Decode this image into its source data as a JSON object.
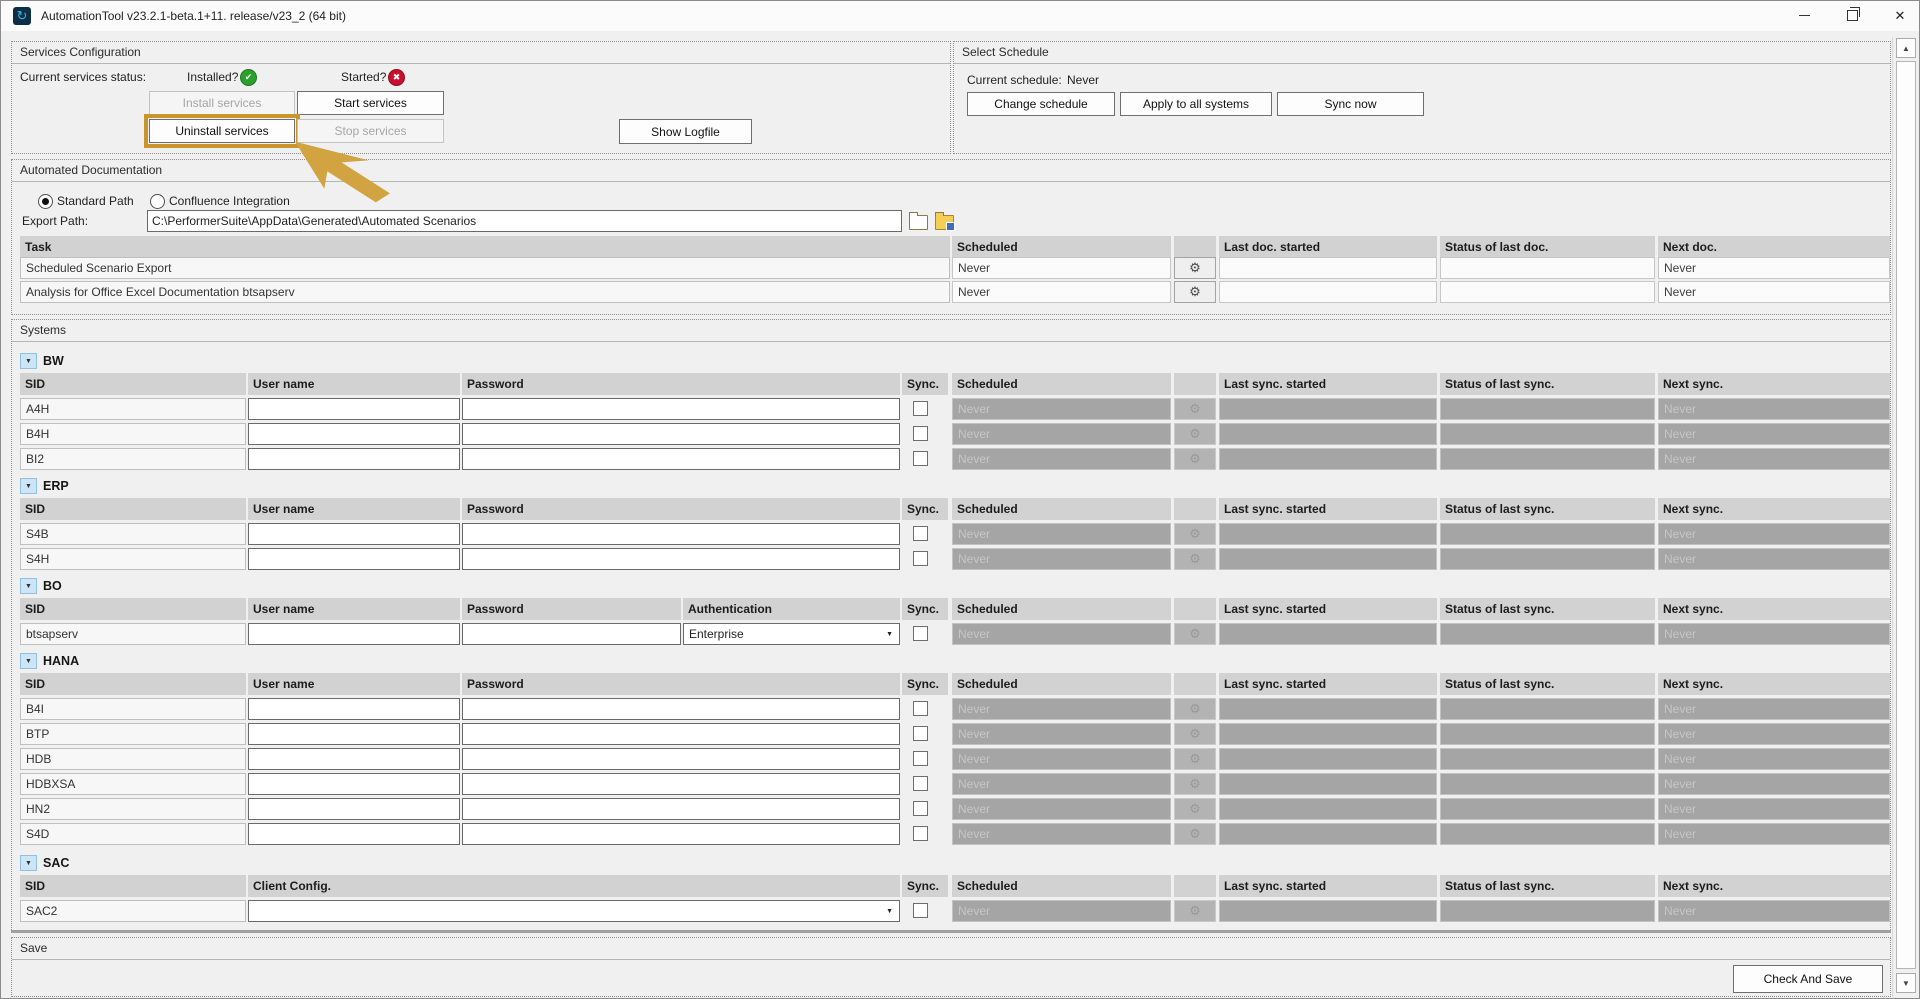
{
  "window": {
    "title": "AutomationTool v23.2.1-beta.1+11. release/v23_2 (64 bit)"
  },
  "icons": {
    "app": "↻",
    "installed": "✔",
    "started": "✖",
    "gear": "⚙",
    "dropdown_arrow": "▼",
    "expander_arrow": "▼",
    "scroll_up": "▲",
    "scroll_down": "▼",
    "close": "✕"
  },
  "colors": {
    "highlight_orange": "#C9962E",
    "pointer_gold": "#D2A441",
    "installed_green": "#2CA02C",
    "started_red": "#C8102E",
    "disabled_cell_gray": "#A5A5A5",
    "header_gray": "#D2D2D2",
    "expander_blue": "#CDE6F7"
  },
  "services_configuration": {
    "title": "Services Configuration",
    "status_label": "Current services status:",
    "installed_label": "Installed?",
    "started_label": "Started?",
    "install_button": "Install services",
    "start_button": "Start services",
    "uninstall_button": "Uninstall services",
    "stop_button": "Stop services",
    "show_logfile_button": "Show Logfile"
  },
  "select_schedule": {
    "title": "Select Schedule",
    "current_schedule_label": "Current schedule:",
    "current_schedule_value": "Never",
    "change_schedule_button": "Change schedule",
    "apply_button": "Apply to all systems",
    "sync_now_button": "Sync now"
  },
  "automated_documentation": {
    "title": "Automated Documentation",
    "standard_path_radio": "Standard Path",
    "confluence_radio": "Confluence Integration",
    "export_path_label": "Export Path:",
    "export_path_value": "C:\\PerformerSuite\\AppData\\Generated\\Automated Scenarios",
    "headers": {
      "task": "Task",
      "scheduled": "Scheduled",
      "last": "Last doc. started",
      "status": "Status of last doc.",
      "next": "Next doc."
    },
    "rows": [
      {
        "task": "Scheduled Scenario Export",
        "scheduled": "Never",
        "last": "",
        "status": "",
        "next": "Never"
      },
      {
        "task": "Analysis for Office Excel Documentation btsapserv",
        "scheduled": "Never",
        "last": "",
        "status": "",
        "next": "Never"
      }
    ]
  },
  "systems": {
    "title": "Systems",
    "headers": {
      "sid": "SID",
      "user": "User name",
      "password": "Password",
      "auth": "Authentication",
      "client": "Client Config.",
      "sync": "Sync.",
      "scheduled": "Scheduled",
      "last": "Last sync. started",
      "status": "Status of last sync.",
      "next": "Next sync."
    },
    "groups": [
      {
        "name": "BW",
        "rows": [
          {
            "sid": "A4H",
            "user": "",
            "password": "",
            "sync_checked": false,
            "scheduled": "Never",
            "last": "",
            "status": "",
            "next": "Never"
          },
          {
            "sid": "B4H",
            "user": "",
            "password": "",
            "sync_checked": false,
            "scheduled": "Never",
            "last": "",
            "status": "",
            "next": "Never"
          },
          {
            "sid": "BI2",
            "user": "",
            "password": "",
            "sync_checked": false,
            "scheduled": "Never",
            "last": "",
            "status": "",
            "next": "Never"
          }
        ]
      },
      {
        "name": "ERP",
        "rows": [
          {
            "sid": "S4B",
            "user": "",
            "password": "",
            "sync_checked": false,
            "scheduled": "Never",
            "last": "",
            "status": "",
            "next": "Never"
          },
          {
            "sid": "S4H",
            "user": "",
            "password": "",
            "sync_checked": false,
            "scheduled": "Never",
            "last": "",
            "status": "",
            "next": "Never"
          }
        ]
      },
      {
        "name": "BO",
        "rows": [
          {
            "sid": "btsapserv",
            "user": "",
            "password": "",
            "auth": "Enterprise",
            "sync_checked": false,
            "scheduled": "Never",
            "last": "",
            "status": "",
            "next": "Never"
          }
        ]
      },
      {
        "name": "HANA",
        "rows": [
          {
            "sid": "B4I",
            "user": "",
            "password": "",
            "sync_checked": false,
            "scheduled": "Never",
            "last": "",
            "status": "",
            "next": "Never"
          },
          {
            "sid": "BTP",
            "user": "",
            "password": "",
            "sync_checked": false,
            "scheduled": "Never",
            "last": "",
            "status": "",
            "next": "Never"
          },
          {
            "sid": "HDB",
            "user": "",
            "password": "",
            "sync_checked": false,
            "scheduled": "Never",
            "last": "",
            "status": "",
            "next": "Never"
          },
          {
            "sid": "HDBXSA",
            "user": "",
            "password": "",
            "sync_checked": false,
            "scheduled": "Never",
            "last": "",
            "status": "",
            "next": "Never"
          },
          {
            "sid": "HN2",
            "user": "",
            "password": "",
            "sync_checked": false,
            "scheduled": "Never",
            "last": "",
            "status": "",
            "next": "Never"
          },
          {
            "sid": "S4D",
            "user": "",
            "password": "",
            "sync_checked": false,
            "scheduled": "Never",
            "last": "",
            "status": "",
            "next": "Never"
          }
        ]
      },
      {
        "name": "SAC",
        "rows": [
          {
            "sid": "SAC2",
            "client_config": "",
            "sync_checked": false,
            "scheduled": "Never",
            "last": "",
            "status": "",
            "next": "Never"
          }
        ]
      }
    ]
  },
  "save_section": {
    "title": "Save",
    "check_and_save_button": "Check And Save"
  }
}
